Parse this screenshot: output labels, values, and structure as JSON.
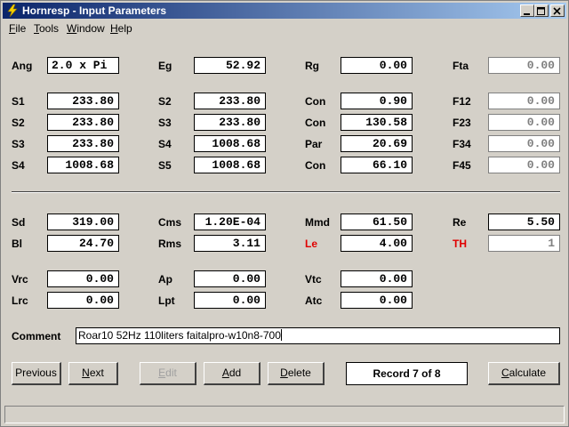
{
  "window": {
    "title": "Hornresp - Input Parameters"
  },
  "menu": [
    {
      "label": "File",
      "key": "F",
      "rest": "ile"
    },
    {
      "label": "Tools",
      "key": "T",
      "rest": "ools"
    },
    {
      "label": "Window",
      "key": "W",
      "rest": "indow"
    },
    {
      "label": "Help",
      "key": "H",
      "rest": "elp"
    }
  ],
  "params": {
    "ang": {
      "label": "Ang",
      "value": "2.0 x Pi"
    },
    "eg": {
      "label": "Eg",
      "value": "52.92"
    },
    "rg": {
      "label": "Rg",
      "value": "0.00"
    },
    "fta": {
      "label": "Fta",
      "value": "0.00"
    },
    "s1a": {
      "label": "S1",
      "value": "233.80"
    },
    "s2b": {
      "label": "S2",
      "value": "233.80"
    },
    "con1": {
      "label": "Con",
      "value": "0.90"
    },
    "f12": {
      "label": "F12",
      "value": "0.00"
    },
    "s2a": {
      "label": "S2",
      "value": "233.80"
    },
    "s3b": {
      "label": "S3",
      "value": "233.80"
    },
    "con2": {
      "label": "Con",
      "value": "130.58"
    },
    "f23": {
      "label": "F23",
      "value": "0.00"
    },
    "s3a": {
      "label": "S3",
      "value": "233.80"
    },
    "s4b": {
      "label": "S4",
      "value": "1008.68"
    },
    "par": {
      "label": "Par",
      "value": "20.69"
    },
    "f34": {
      "label": "F34",
      "value": "0.00"
    },
    "s4a": {
      "label": "S4",
      "value": "1008.68"
    },
    "s5b": {
      "label": "S5",
      "value": "1008.68"
    },
    "con3": {
      "label": "Con",
      "value": "66.10"
    },
    "f45": {
      "label": "F45",
      "value": "0.00"
    },
    "sd": {
      "label": "Sd",
      "value": "319.00"
    },
    "cms": {
      "label": "Cms",
      "value": "1.20E-04"
    },
    "mmd": {
      "label": "Mmd",
      "value": "61.50"
    },
    "re": {
      "label": "Re",
      "value": "5.50"
    },
    "bl": {
      "label": "Bl",
      "value": "24.70"
    },
    "rms": {
      "label": "Rms",
      "value": "3.11"
    },
    "le": {
      "label": "Le",
      "value": "4.00"
    },
    "th": {
      "label": "TH",
      "value": "1"
    },
    "vrc": {
      "label": "Vrc",
      "value": "0.00"
    },
    "ap": {
      "label": "Ap",
      "value": "0.00"
    },
    "vtc": {
      "label": "Vtc",
      "value": "0.00"
    },
    "lrc": {
      "label": "Lrc",
      "value": "0.00"
    },
    "lpt": {
      "label": "Lpt",
      "value": "0.00"
    },
    "atc": {
      "label": "Atc",
      "value": "0.00"
    }
  },
  "comment": {
    "label": "Comment",
    "value": "Roar10 52Hz 110liters faitalpro-w10n8-700"
  },
  "buttons": {
    "previous": {
      "label": "Previous",
      "key": "",
      "rest": "Previous"
    },
    "next": {
      "label": "Next",
      "key": "N",
      "rest": "ext"
    },
    "edit": {
      "label": "Edit",
      "key": "E",
      "rest": "dit"
    },
    "add": {
      "label": "Add",
      "key": "A",
      "rest": "dd"
    },
    "delete": {
      "label": "Delete",
      "key": "D",
      "rest": "elete"
    },
    "calculate": {
      "label": "Calculate",
      "key": "C",
      "rest": "alculate"
    }
  },
  "record": "Record 7 of 8",
  "colors": {
    "title_start": "#0a246a",
    "title_end": "#a6caf0",
    "highlight_label": "#e00000",
    "face": "#d4d0c8"
  }
}
